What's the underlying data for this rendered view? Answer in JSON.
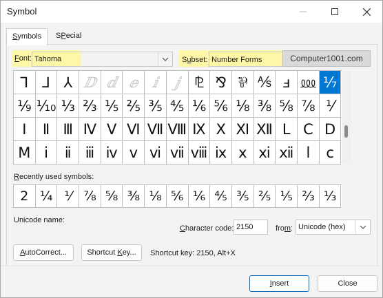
{
  "window": {
    "title": "Symbol"
  },
  "tabs": [
    {
      "label_ak": "S",
      "label_rest": "ymbols"
    },
    {
      "label_ak": "P",
      "label_rest": "ecial Characters",
      "label_pre": "S"
    }
  ],
  "font": {
    "label_ak": "F",
    "label_rest": "ont:",
    "value": "Tahoma"
  },
  "subset": {
    "label_pre": "S",
    "label_ak": "u",
    "label_rest": "bset:",
    "value": "Number Forms"
  },
  "watermark": "Computer1001.com",
  "symbols": {
    "rows": [
      [
        "⅂",
        "⅃",
        "⅄",
        "ⅅ",
        "ⅆ",
        "ⅇ",
        "ⅈ",
        "ⅉ",
        "⅊",
        "⅋",
        "⅌",
        "⅍",
        "ⅎ",
        "⅏",
        "⅐"
      ],
      [
        "⅑",
        "⅒",
        "⅓",
        "⅔",
        "⅕",
        "⅖",
        "⅗",
        "⅘",
        "⅙",
        "⅚",
        "⅛",
        "⅜",
        "⅝",
        "⅞",
        "⅟"
      ],
      [
        "Ⅰ",
        "Ⅱ",
        "Ⅲ",
        "Ⅳ",
        "Ⅴ",
        "Ⅵ",
        "Ⅶ",
        "Ⅷ",
        "Ⅸ",
        "Ⅹ",
        "Ⅺ",
        "Ⅻ",
        "Ⅼ",
        "Ⅽ",
        "Ⅾ"
      ],
      [
        "Ⅿ",
        "ⅰ",
        "ⅱ",
        "ⅲ",
        "ⅳ",
        "ⅴ",
        "ⅵ",
        "ⅶ",
        "ⅷ",
        "ⅸ",
        "ⅹ",
        "ⅺ",
        "ⅻ",
        "ⅼ",
        "ⅽ"
      ]
    ],
    "dim": [
      [
        0,
        3
      ],
      [
        0,
        4
      ],
      [
        0,
        5
      ],
      [
        0,
        6
      ],
      [
        0,
        7
      ]
    ],
    "selected": [
      0,
      14
    ]
  },
  "recent": {
    "label_ak": "R",
    "label_rest": "ecently used symbols:",
    "items": [
      "2",
      "¼",
      "⅟",
      "⅞",
      "⅝",
      "⅜",
      "⅛",
      "⅚",
      "⅙",
      "⅘",
      "⅗",
      "⅖",
      "⅕",
      "⅔",
      "⅓"
    ]
  },
  "unicode_name_label": "Unicode name:",
  "char_code": {
    "label_ak": "C",
    "label_rest": "haracter code:",
    "value": "2150"
  },
  "from": {
    "label_pre": "fro",
    "label_ak": "m",
    "label_rest": ":",
    "value": "Unicode (hex)"
  },
  "autocorrect_button": {
    "label_pre": "",
    "label_ak": "A",
    "label_rest": "utoCorrect..."
  },
  "shortcut_key_button": {
    "label_pre": "Shortcut ",
    "label_ak": "K",
    "label_rest": "ey..."
  },
  "shortcut_text": "Shortcut key: 2150, Alt+X",
  "insert_button": {
    "label_ak": "I",
    "label_rest": "nsert"
  },
  "close_button": {
    "label": "Close"
  },
  "colors": {
    "selected": "#0078d4",
    "highlight": "#fff7a8"
  }
}
